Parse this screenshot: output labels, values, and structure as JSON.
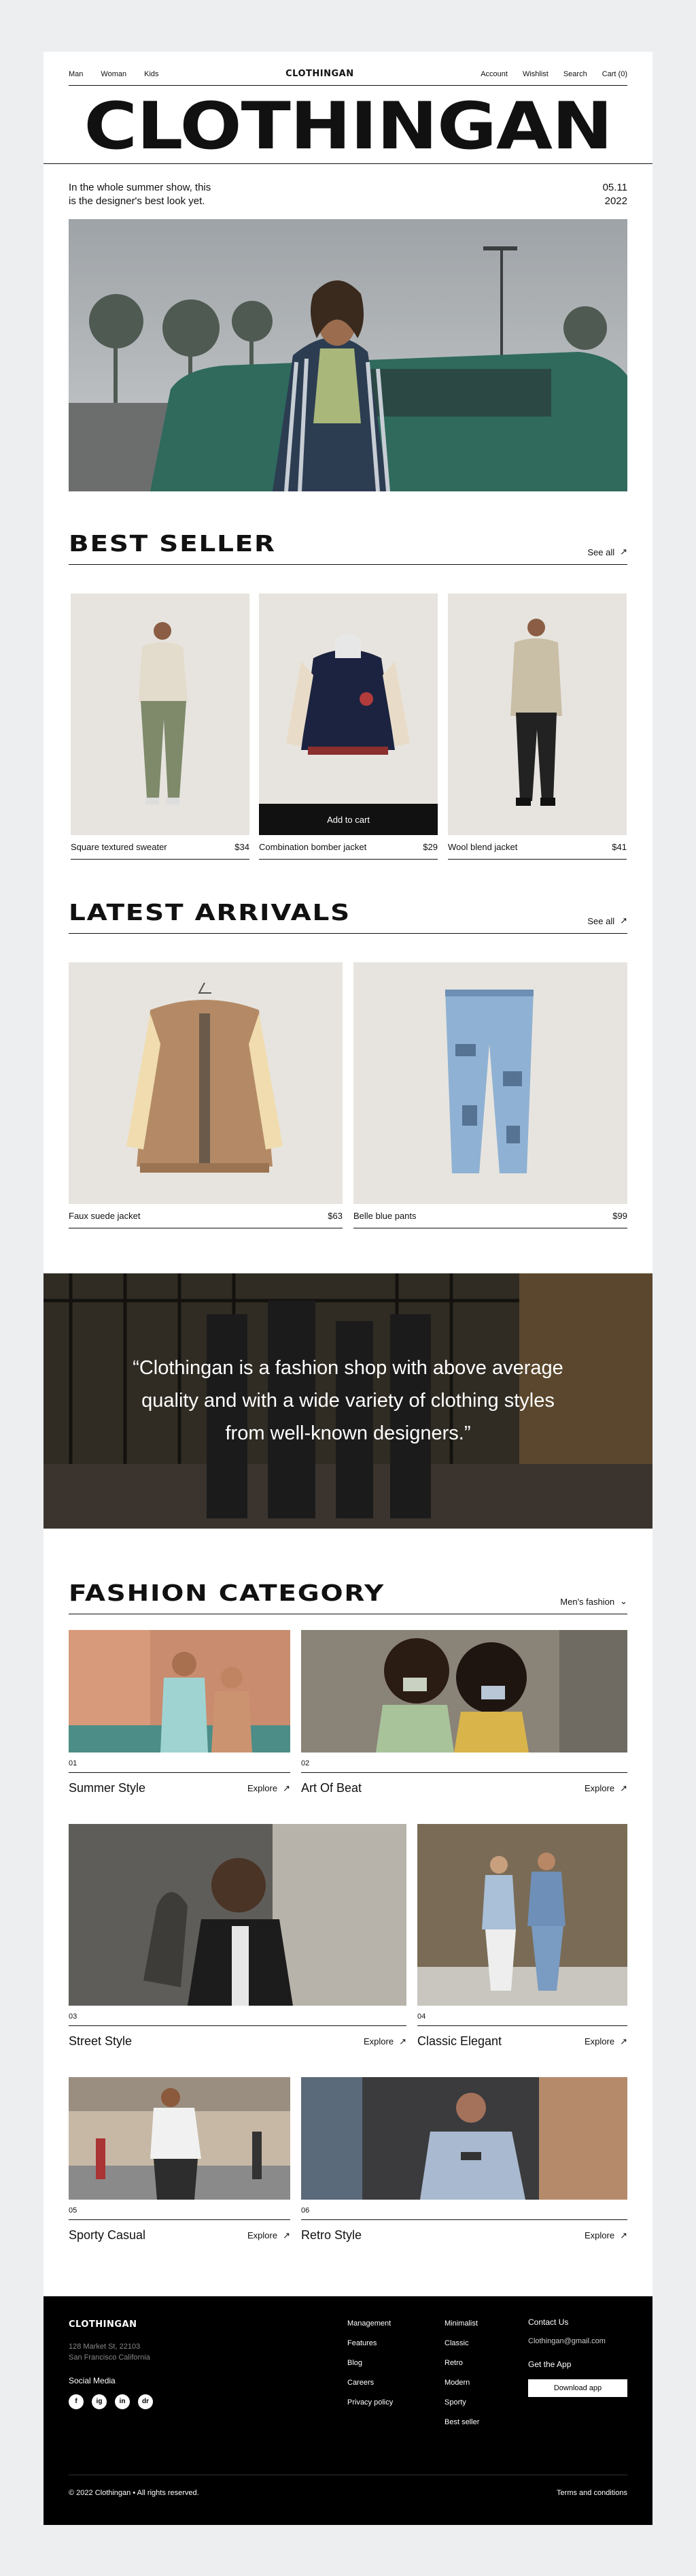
{
  "nav": {
    "left": [
      "Man",
      "Woman",
      "Kids"
    ],
    "brand": "CLOTHINGAN",
    "right": [
      "Account",
      "Wishlist",
      "Search",
      "Cart (0)"
    ]
  },
  "hero": {
    "wordmark": "CLOTHINGAN",
    "intro_line1": "In the whole summer show, this",
    "intro_line2": "is the designer's best look yet.",
    "date_line1": "05.11",
    "date_line2": "2022"
  },
  "best_seller": {
    "title": "BEST SELLER",
    "see_all": "See all",
    "add_to_cart": "Add to cart",
    "items": [
      {
        "name": "Square textured sweater",
        "price": "$34"
      },
      {
        "name": "Combination bomber jacket",
        "price": "$29"
      },
      {
        "name": "Wool blend jacket",
        "price": "$41"
      }
    ]
  },
  "latest": {
    "title": "LATEST ARRIVALS",
    "see_all": "See all",
    "items": [
      {
        "name": "Faux suede jacket",
        "price": "$63"
      },
      {
        "name": "Belle blue pants",
        "price": "$99"
      }
    ]
  },
  "quote": {
    "line1": "“Clothingan is a fashion shop with above average",
    "line2": "quality and with a wide variety of clothing styles",
    "line3": "from well-known designers.”"
  },
  "category": {
    "title": "FASHION CATEGORY",
    "filter": "Men's fashion",
    "explore": "Explore",
    "items": [
      {
        "num": "01",
        "name": "Summer Style"
      },
      {
        "num": "02",
        "name": "Art Of Beat"
      },
      {
        "num": "03",
        "name": "Street Style"
      },
      {
        "num": "04",
        "name": "Classic Elegant"
      },
      {
        "num": "05",
        "name": "Sporty Casual"
      },
      {
        "num": "06",
        "name": "Retro Style"
      }
    ]
  },
  "footer": {
    "brand": "CLOTHINGAN",
    "address1": "128 Market St, 22103",
    "address2": "San Francisco California",
    "social_title": "Social Media",
    "social": [
      "f",
      "ig",
      "in",
      "dr"
    ],
    "col1": [
      "Management",
      "Features",
      "Blog",
      "Careers",
      "Privacy policy"
    ],
    "col2": [
      "Minimalist",
      "Classic",
      "Retro",
      "Modern",
      "Sporty",
      "Best seller"
    ],
    "contact_title": "Contact Us",
    "email": "Clothingan@gmail.com",
    "app_title": "Get the App",
    "download": "Download app",
    "copyright": "© 2022 Clothingan • All rights reserved.",
    "terms": "Terms and conditions"
  },
  "colors": {
    "accent": "#111111",
    "card_bg": "#e9e6e2",
    "footer_bg": "#000000"
  }
}
